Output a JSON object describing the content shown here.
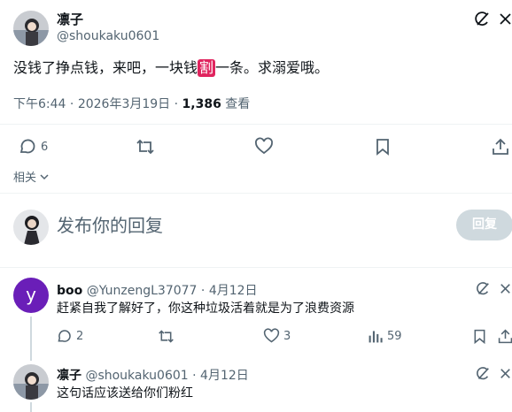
{
  "tweet": {
    "author_name": "凛子",
    "author_handle": "@shoukaku0601",
    "text_before": "没钱了挣点钱，来吧，一块钱",
    "emoji_badge": "割",
    "text_after": "一条。求溺爱哦。",
    "time": "下午6:44",
    "date": "2026年3月19日",
    "views_count": "1,386",
    "views_label": "查看",
    "reply_count": "6",
    "related_label": "相关"
  },
  "compose": {
    "placeholder": "发布你的回复",
    "button_label": "回复"
  },
  "replies": [
    {
      "avatar_letter": "y",
      "avatar_color": "#6a1eb8",
      "name": "boo",
      "handle": "@YunzengL37077",
      "date": "4月12日",
      "text": "赶紧自我了解好了，你这种垃圾活着就是为了浪费资源",
      "reply_count": "2",
      "like_count": "3",
      "view_count": "59"
    },
    {
      "name": "凛子",
      "handle": "@shoukaku0601",
      "date": "4月12日",
      "text": "这句话应该送给你们粉红"
    }
  ],
  "separator": "·",
  "icons": [
    "grok-icon",
    "more-icon",
    "reply-icon",
    "retweet-icon",
    "like-icon",
    "bookmark-icon",
    "share-icon",
    "chevron-down-icon",
    "views-icon"
  ],
  "colors": {
    "accent": "#1d9bf0",
    "muted": "#536471",
    "badge": "#e0245e",
    "reply_button": "#cfd9de"
  }
}
